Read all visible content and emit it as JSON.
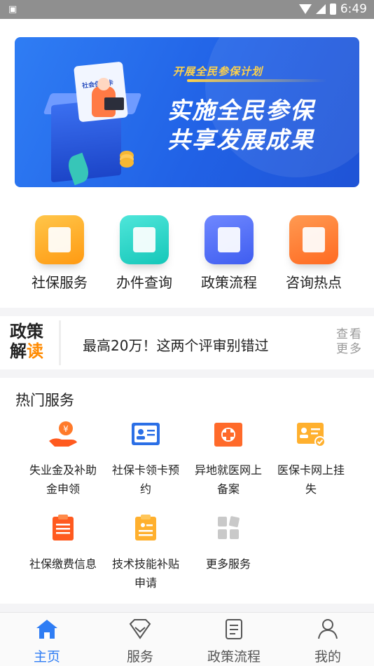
{
  "status_bar": {
    "left_icon": "qr-scan-icon",
    "time": "6:49",
    "icons": [
      "wifi-icon",
      "signal-icon",
      "battery-icon"
    ]
  },
  "banner": {
    "card_label": "社会保障卡",
    "plan_text": "开展全民参保计划",
    "headline_1": "实施全民参保",
    "headline_2": "共享发展成果"
  },
  "quick_actions": [
    {
      "label": "社保服务",
      "icon": "document-search-icon",
      "color": "#ffb02e"
    },
    {
      "label": "办件查询",
      "icon": "book-icon",
      "color": "#22d1c2"
    },
    {
      "label": "政策流程",
      "icon": "message-doc-icon",
      "color": "#4a66f5"
    },
    {
      "label": "咨询热点",
      "icon": "heart-note-icon",
      "color": "#ff7a30"
    }
  ],
  "policy": {
    "badge_line1": "政策",
    "badge_line2a": "解",
    "badge_line2b": "读",
    "headline": "最高20万！这两个评审别错过",
    "more_line1": "查看",
    "more_line2": "更多"
  },
  "hot_services": {
    "title": "热门服务",
    "items": [
      {
        "label_1": "失业金及补助",
        "label_2": "金申领",
        "icon": "hand-coin-icon"
      },
      {
        "label_1": "社保卡领卡预",
        "label_2": "约",
        "icon": "id-card-icon"
      },
      {
        "label_1": "异地就医网上",
        "label_2": "备案",
        "icon": "medical-cross-icon"
      },
      {
        "label_1": "医保卡网上挂",
        "label_2": "失",
        "icon": "card-check-icon"
      },
      {
        "label_1": "社保缴费信息",
        "label_2": "",
        "icon": "clipboard-list-icon"
      },
      {
        "label_1": "技术技能补贴",
        "label_2": "申请",
        "icon": "clipboard-doc-icon"
      },
      {
        "label_1": "更多服务",
        "label_2": "",
        "icon": "grid-more-icon"
      }
    ]
  },
  "tabbar": {
    "items": [
      {
        "label": "主页",
        "icon": "home-icon",
        "active": true
      },
      {
        "label": "服务",
        "icon": "diamond-icon",
        "active": false
      },
      {
        "label": "政策流程",
        "icon": "document-icon",
        "active": false
      },
      {
        "label": "我的",
        "icon": "user-icon",
        "active": false
      }
    ],
    "active_color": "#2f7df4"
  }
}
